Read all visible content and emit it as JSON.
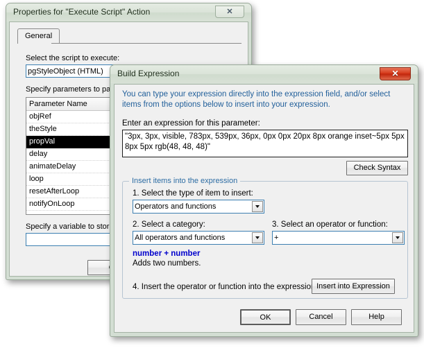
{
  "properties_window": {
    "title": "Properties for \"Execute Script\" Action",
    "close_button": "✕",
    "tab": {
      "label": "General"
    },
    "script_label_pre": "Select the ",
    "script_label_accel": "s",
    "script_label_post": "cript to execute:",
    "script_label": "Select the script to execute:",
    "script_value": "pgStyleObject (HTML)",
    "params_label": "Specify parameters to pass",
    "params_column_header": "Parameter Name",
    "params": [
      {
        "name": "objRef",
        "selected": false
      },
      {
        "name": "theStyle",
        "selected": false
      },
      {
        "name": "propVal",
        "selected": true
      },
      {
        "name": "delay",
        "selected": false
      },
      {
        "name": "animateDelay",
        "selected": false
      },
      {
        "name": "loop",
        "selected": false
      },
      {
        "name": "resetAfterLoop",
        "selected": false
      },
      {
        "name": "notifyOnLoop",
        "selected": false
      }
    ],
    "variable_label": "Specify a variable to store",
    "variable_value": "",
    "ok_button": "O"
  },
  "build_window": {
    "title": "Build Expression",
    "close_button": "✕",
    "intro": "You can type your expression directly into the expression field, and/or select items from the options below to insert into your expression.",
    "expression_label": "Enter an expression for this parameter:",
    "expression_value": "\"3px, 3px, visible, 783px, 539px, 36px, 0px 0px 20px 8px orange inset~5px 5px 8px 5px rgb(48, 48, 48)\"",
    "check_syntax_button": "Check Syntax",
    "group": {
      "title": "Insert items into the expression",
      "step1_label": "1. Select the type of item to insert:",
      "step1_value": "Operators and functions",
      "step2_label": "2. Select a category:",
      "step2_value": "All operators and functions",
      "step3_label": "3. Select an operator or function:",
      "step3_value": "+",
      "description_signature": "number + number",
      "description_body": "Adds two numbers.",
      "step4_label": "4. Insert the operator or function into the expression:",
      "insert_button": "Insert into Expression"
    },
    "ok_button": "OK",
    "cancel_button": "Cancel",
    "help_button": "Help"
  },
  "colors": {
    "window_frame": "#d3ded3",
    "dialog_face": "#f0f0f0",
    "intro_text": "#215f9a",
    "group_title": "#2c6ca3",
    "signature_text": "#0000cc",
    "selection_bg": "#000000",
    "field_border_focus": "#3c7fb1",
    "close_red": "#d63c1c",
    "desktop": "#ffffff"
  }
}
